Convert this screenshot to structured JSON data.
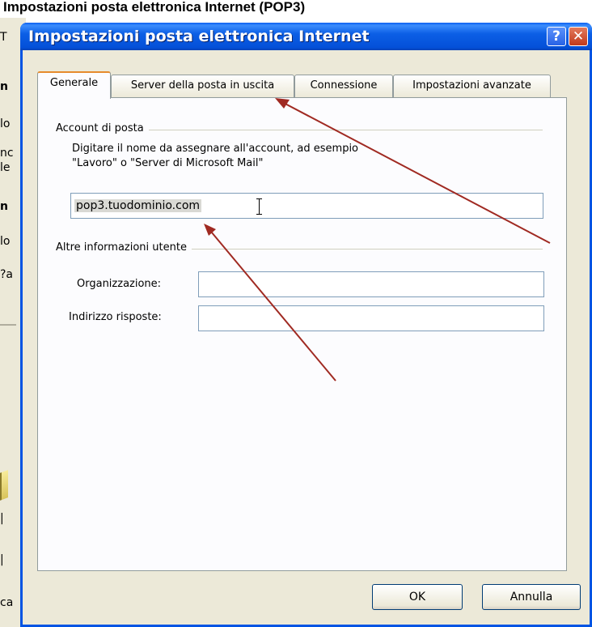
{
  "background_window": {
    "title": "Impostazioni posta elettronica Internet (POP3)",
    "fragments": [
      "T",
      "n",
      "lo",
      "nc",
      "le",
      "n",
      "lo",
      "?a",
      "ca"
    ]
  },
  "dialog": {
    "title": "Impostazioni posta elettronica Internet",
    "help_glyph": "?",
    "close_glyph": "✕",
    "tabs": [
      {
        "label": "Generale",
        "active": true
      },
      {
        "label": "Server della posta in uscita",
        "active": false
      },
      {
        "label": "Connessione",
        "active": false
      },
      {
        "label": "Impostazioni avanzate",
        "active": false
      }
    ],
    "account_group": {
      "label": "Account di posta",
      "description_line1": "Digitare il nome da assegnare all'account, ad esempio",
      "description_line2": "\"Lavoro\" o \"Server di Microsoft Mail\"",
      "account_value": "pop3.tuodominio.com"
    },
    "user_group": {
      "label": "Altre informazioni utente",
      "organization_label": "Organizzazione:",
      "organization_value": "",
      "reply_label": "Indirizzo risposte:",
      "reply_value": ""
    },
    "buttons": {
      "ok": "OK",
      "cancel": "Annulla"
    }
  },
  "annotation_color": "#a02a22"
}
